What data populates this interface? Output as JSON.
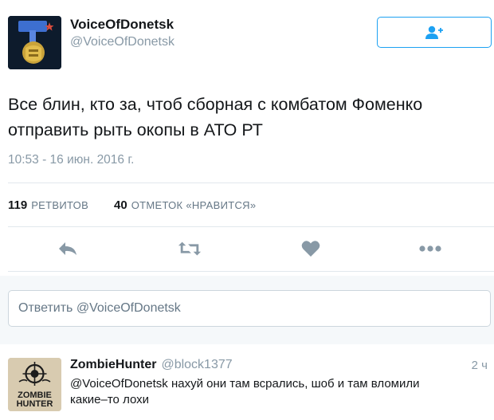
{
  "author": {
    "name": "VoiceOfDonetsk",
    "handle": "@VoiceOfDonetsk"
  },
  "tweet": {
    "text_line1": "Все блин, кто за, чтоб сборная с комбатом Фоменко",
    "text_line2": "отправить рыть окопы в АТО РТ",
    "timestamp": "10:53 - 16 июн. 2016 г."
  },
  "stats": {
    "retweets_count": "119",
    "retweets_label": "РЕТВИТОВ",
    "likes_count": "40",
    "likes_label": "ОТМЕТОК «НРАВИТСЯ»"
  },
  "actions": [
    "reply-icon",
    "retweet-icon",
    "heart-icon",
    "more-icon"
  ],
  "reply_box": {
    "placeholder": "Ответить @VoiceOfDonetsk"
  },
  "reply": {
    "name": "ZombieHunter",
    "handle": "@block1377",
    "time": "2 ч",
    "text_line1": "@VoiceOfDonetsk нахуй они там всрались, шоб и там вломили",
    "text_line2": "какие–то лохи",
    "avatar_text_1": "ZOMBIE",
    "avatar_text_2": "HUNTER"
  },
  "colors": {
    "accent": "#1da1f2",
    "icon_gray": "#8899a6",
    "divider": "#e1e8ed",
    "reply_bg": "#f5f8fa"
  }
}
